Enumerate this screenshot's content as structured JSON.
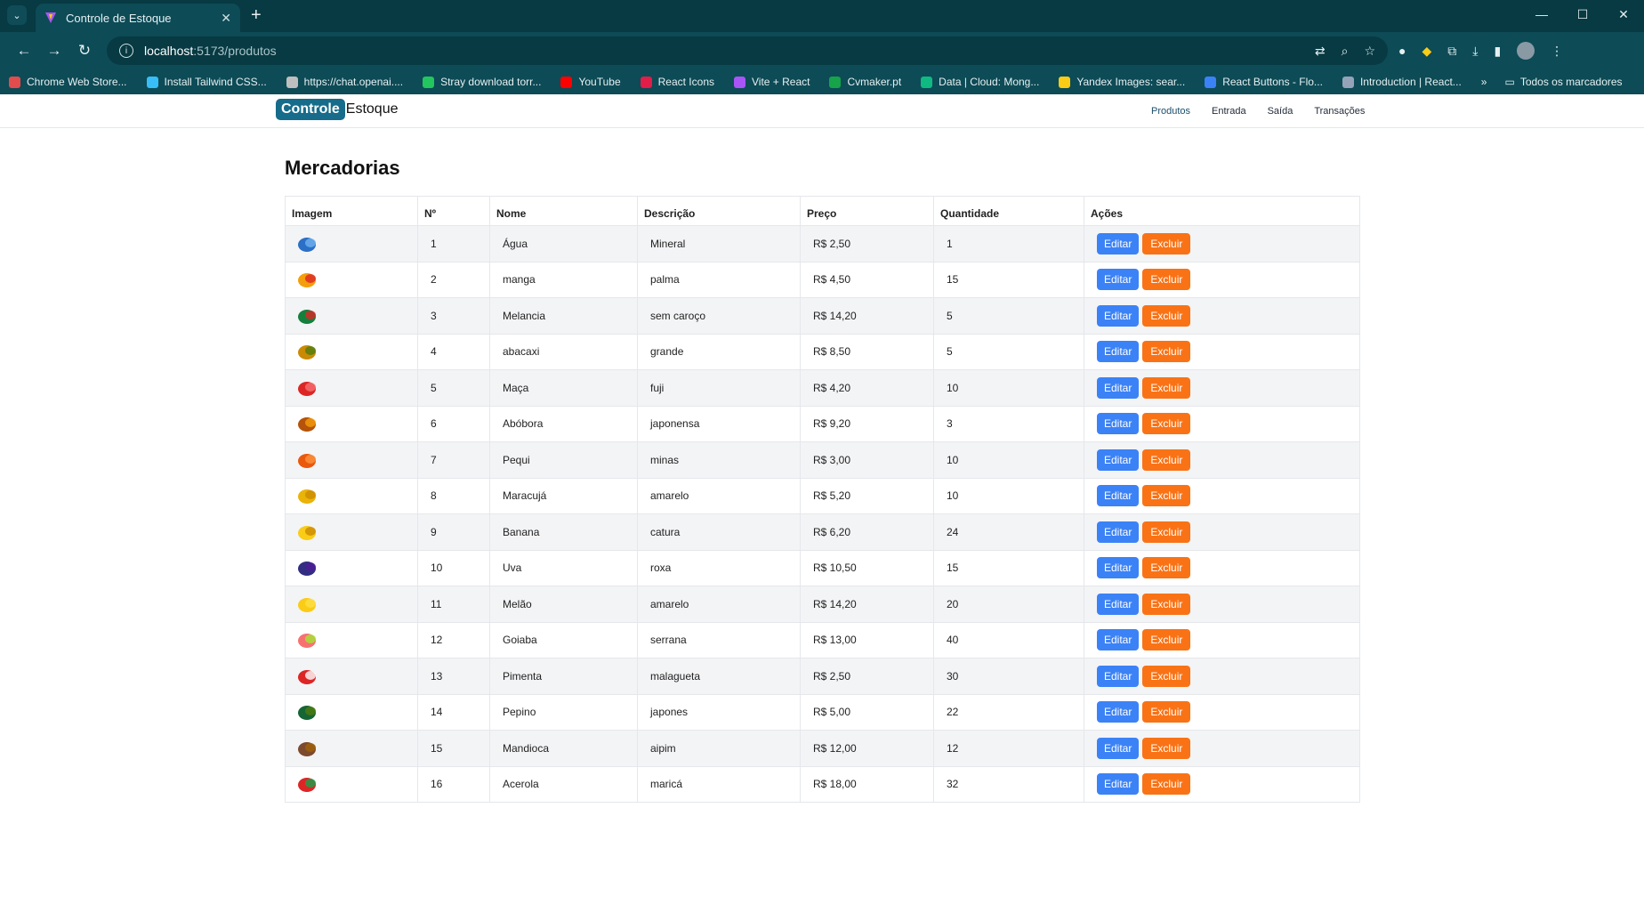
{
  "browser": {
    "tab_title": "Controle de Estoque",
    "url_host": "localhost",
    "url_path": ":5173/produtos",
    "bookmarks": [
      {
        "label": "Chrome Web Store...",
        "color": "#e34c4c"
      },
      {
        "label": "Install Tailwind CSS...",
        "color": "#38bdf8"
      },
      {
        "label": "https://chat.openai....",
        "color": "#bfbfbf"
      },
      {
        "label": "Stray download torr...",
        "color": "#22c55e"
      },
      {
        "label": "YouTube",
        "color": "#ff0000"
      },
      {
        "label": "React Icons",
        "color": "#e11d48"
      },
      {
        "label": "Vite + React",
        "color": "#a855f7"
      },
      {
        "label": "Cvmaker.pt",
        "color": "#16a34a"
      },
      {
        "label": "Data | Cloud: Mong...",
        "color": "#10b981"
      },
      {
        "label": "Yandex Images: sear...",
        "color": "#facc15"
      },
      {
        "label": "React Buttons - Flo...",
        "color": "#3b82f6"
      },
      {
        "label": "Introduction | React...",
        "color": "#94a3b8"
      }
    ],
    "bookmarks_more": "»",
    "all_bookmarks": "Todos os marcadores"
  },
  "app": {
    "logo_part1": "Controle",
    "logo_part2": "Estoque",
    "nav": [
      "Produtos",
      "Entrada",
      "Saída",
      "Transações"
    ]
  },
  "page": {
    "title": "Mercadorias",
    "columns": [
      "Imagem",
      "Nº",
      "Nome",
      "Descrição",
      "Preço",
      "Quantidade",
      "Ações"
    ],
    "edit_label": "Editar",
    "delete_label": "Excluir",
    "rows": [
      {
        "n": "1",
        "nome": "Água",
        "desc": "Mineral",
        "preco": "R$ 2,50",
        "qtd": "1",
        "icon": "water-bottle-icon",
        "c1": "#2b6fc7",
        "c2": "#6fb3f0"
      },
      {
        "n": "2",
        "nome": "manga",
        "desc": "palma",
        "preco": "R$ 4,50",
        "qtd": "15",
        "icon": "mango-icon",
        "c1": "#f59e0b",
        "c2": "#dc2626"
      },
      {
        "n": "3",
        "nome": "Melancia",
        "desc": "sem caroço",
        "preco": "R$ 14,20",
        "qtd": "5",
        "icon": "watermelon-icon",
        "c1": "#15803d",
        "c2": "#dc2626"
      },
      {
        "n": "4",
        "nome": "abacaxi",
        "desc": "grande",
        "preco": "R$ 8,50",
        "qtd": "5",
        "icon": "pineapple-icon",
        "c1": "#ca8a04",
        "c2": "#4d7c0f"
      },
      {
        "n": "5",
        "nome": "Maça",
        "desc": "fuji",
        "preco": "R$ 4,20",
        "qtd": "10",
        "icon": "apple-icon",
        "c1": "#dc2626",
        "c2": "#f87171"
      },
      {
        "n": "6",
        "nome": "Abóbora",
        "desc": "japonensa",
        "preco": "R$ 9,20",
        "qtd": "3",
        "icon": "pumpkin-icon",
        "c1": "#b45309",
        "c2": "#f59e0b"
      },
      {
        "n": "7",
        "nome": "Pequi",
        "desc": "minas",
        "preco": "R$ 3,00",
        "qtd": "10",
        "icon": "pequi-icon",
        "c1": "#ea580c",
        "c2": "#fb923c"
      },
      {
        "n": "8",
        "nome": "Maracujá",
        "desc": "amarelo",
        "preco": "R$ 5,20",
        "qtd": "10",
        "icon": "passion-fruit-icon",
        "c1": "#eab308",
        "c2": "#ca8a04"
      },
      {
        "n": "9",
        "nome": "Banana",
        "desc": "catura",
        "preco": "R$ 6,20",
        "qtd": "24",
        "icon": "banana-icon",
        "c1": "#facc15",
        "c2": "#ca8a04"
      },
      {
        "n": "10",
        "nome": "Uva",
        "desc": "roxa",
        "preco": "R$ 10,50",
        "qtd": "15",
        "icon": "grape-icon",
        "c1": "#312e81",
        "c2": "#4c1d95"
      },
      {
        "n": "11",
        "nome": "Melão",
        "desc": "amarelo",
        "preco": "R$ 14,20",
        "qtd": "20",
        "icon": "melon-icon",
        "c1": "#facc15",
        "c2": "#fde047"
      },
      {
        "n": "12",
        "nome": "Goiaba",
        "desc": "serrana",
        "preco": "R$ 13,00",
        "qtd": "40",
        "icon": "guava-icon",
        "c1": "#f87171",
        "c2": "#a3e635"
      },
      {
        "n": "13",
        "nome": "Pimenta",
        "desc": "malagueta",
        "preco": "R$ 2,50",
        "qtd": "30",
        "icon": "pepper-icon",
        "c1": "#dc2626",
        "c2": "#ffffff"
      },
      {
        "n": "14",
        "nome": "Pepino",
        "desc": "japones",
        "preco": "R$ 5,00",
        "qtd": "22",
        "icon": "cucumber-icon",
        "c1": "#166534",
        "c2": "#4d7c0f"
      },
      {
        "n": "15",
        "nome": "Mandioca",
        "desc": "aipim",
        "preco": "R$ 12,00",
        "qtd": "12",
        "icon": "cassava-icon",
        "c1": "#7c4a2d",
        "c2": "#a16207"
      },
      {
        "n": "16",
        "nome": "Acerola",
        "desc": "maricá",
        "preco": "R$ 18,00",
        "qtd": "32",
        "icon": "acerola-icon",
        "c1": "#dc2626",
        "c2": "#16a34a"
      }
    ]
  }
}
